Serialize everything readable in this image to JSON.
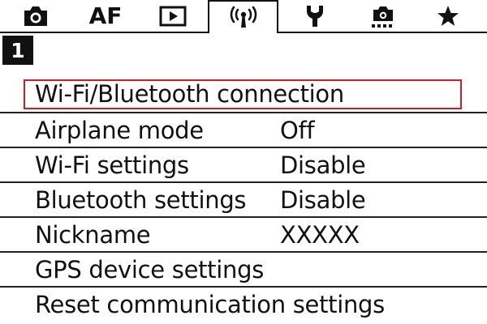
{
  "tabs": [
    {
      "id": "shooting",
      "icon": "camera-icon",
      "label": ""
    },
    {
      "id": "af",
      "icon": "",
      "label": "AF"
    },
    {
      "id": "playback",
      "icon": "playback-icon",
      "label": ""
    },
    {
      "id": "wireless",
      "icon": "wireless-icon",
      "label": "",
      "active": true
    },
    {
      "id": "setup",
      "icon": "wrench-icon",
      "label": ""
    },
    {
      "id": "custom",
      "icon": "custom-functions-icon",
      "label": ""
    },
    {
      "id": "my-menu",
      "icon": "star-icon",
      "label": ""
    }
  ],
  "page_number": "1",
  "menu": {
    "items": [
      {
        "label": "Wi-Fi/Bluetooth connection",
        "value": "",
        "selected": true
      },
      {
        "label": "Airplane mode",
        "value": "Off"
      },
      {
        "label": "Wi-Fi settings",
        "value": "Disable"
      },
      {
        "label": "Bluetooth settings",
        "value": "Disable"
      },
      {
        "label": "Nickname",
        "value": "XXXXX"
      },
      {
        "label": "GPS device settings",
        "value": ""
      },
      {
        "label": "Reset communication settings",
        "value": ""
      }
    ]
  },
  "colors": {
    "selection_border": "#d21a2a",
    "text": "#111111",
    "background": "#ffffff"
  }
}
